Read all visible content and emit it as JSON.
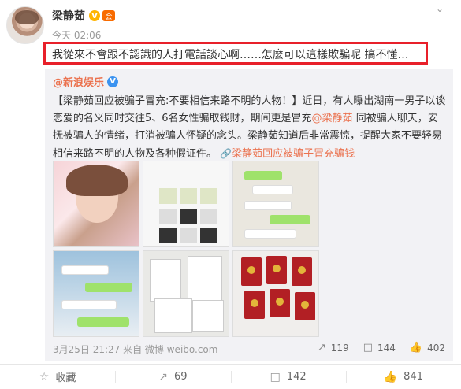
{
  "post": {
    "author": "梁静茹",
    "v_badge": "V",
    "member_badge": "会",
    "time": "今天 02:06",
    "text": "我從來不會跟不認識的人打電話談心啊……怎麼可以這樣欺騙呢  搞不懂…"
  },
  "repost": {
    "handle": "@新浪娱乐",
    "badge": "V",
    "text_part1": "【梁静茹回应被骗子冒充:不要相信来路不明的人物！】近日，有人曝出湖南一男子以谈恋爱的名义同时交往5、6名女性骗取钱财，期间更是冒充",
    "mention": "@梁静茹",
    "text_part2": " 同被骗人聊天，安抚被骗人的情绪，打消被骗人怀疑的念头。梁静茹知道后非常震惊，提醒大家不要轻易相信来路不明的人物及各种假证件。",
    "topic": "梁静茹回应被骗子冒充骗钱",
    "footer": "3月25日 21:27 来自 微博 weibo.com",
    "actions": {
      "forward": "119",
      "comment": "144",
      "like": "402"
    }
  },
  "action_bar": {
    "favorite": "收藏",
    "forward": "69",
    "comment": "142",
    "like": "841"
  },
  "icons": {
    "chevron": "chevron-down-icon",
    "forward": "forward-icon",
    "comment": "comment-icon",
    "like": "thumbs-up-icon",
    "favorite": "star-icon",
    "topic": "link-icon"
  },
  "colors": {
    "accent": "#eb7350",
    "highlight_box": "#e8202a",
    "repost_bg": "#f2f2f5"
  }
}
